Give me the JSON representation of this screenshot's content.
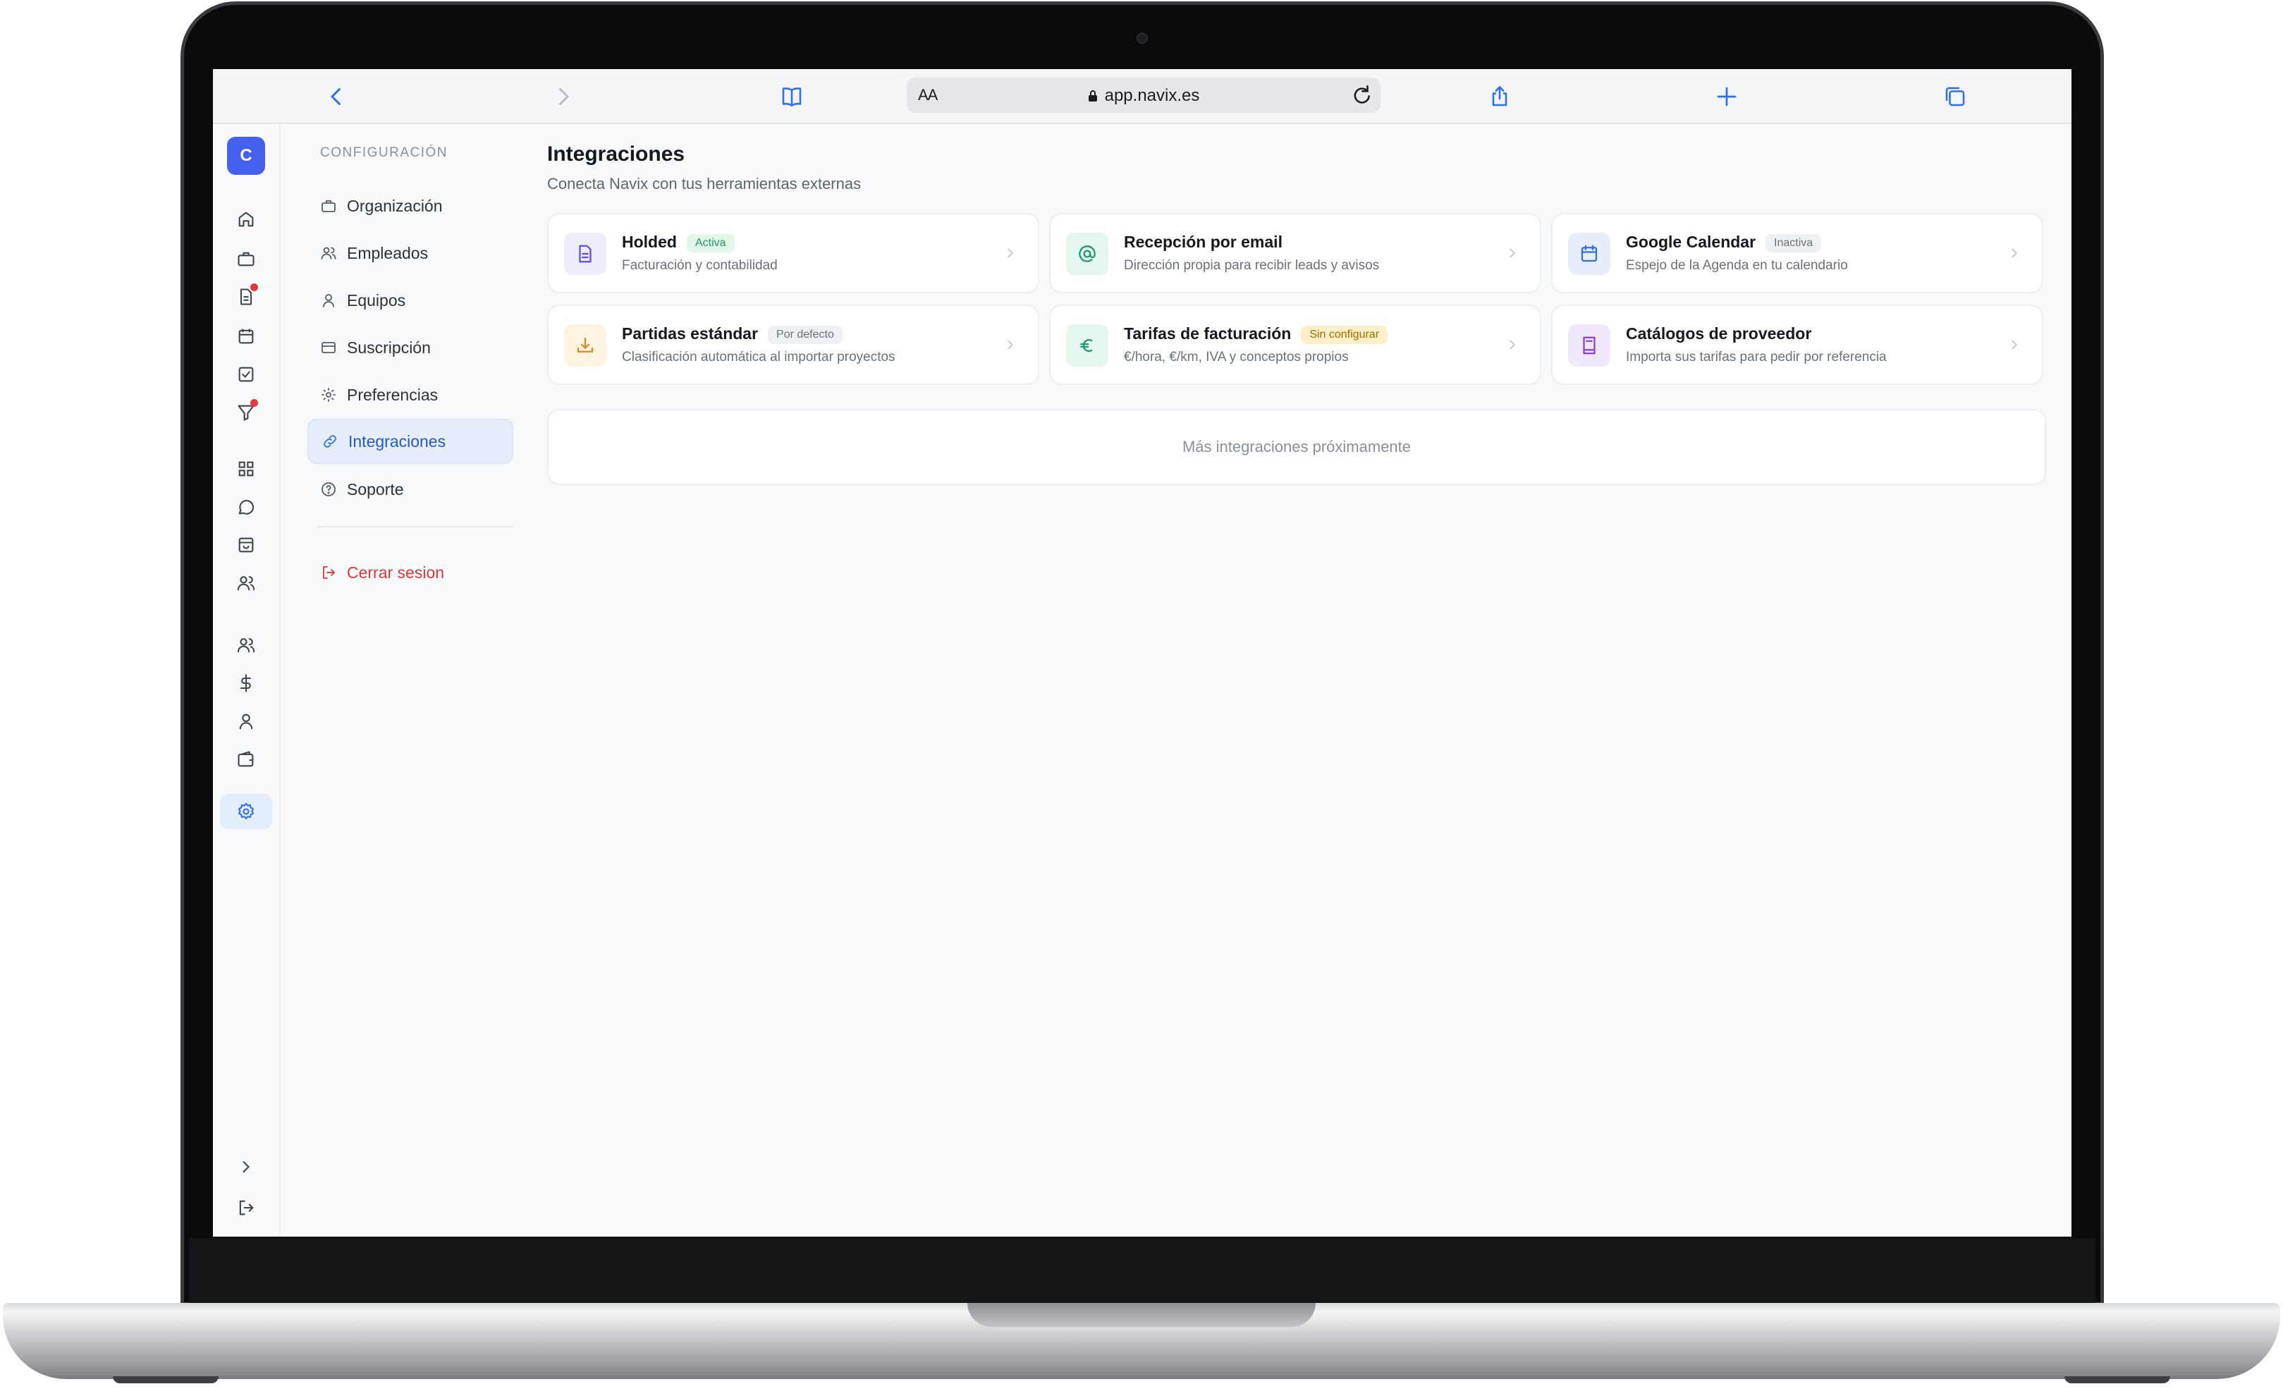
{
  "browser": {
    "url": "app.navix.es",
    "reader_label": "AA"
  },
  "rail": {
    "avatar_initial": "C"
  },
  "nav": {
    "section_title": "CONFIGURACIÓN",
    "items": [
      {
        "label": "Organización",
        "icon": "briefcase-icon"
      },
      {
        "label": "Empleados",
        "icon": "users-icon"
      },
      {
        "label": "Equipos",
        "icon": "user-icon"
      },
      {
        "label": "Suscripción",
        "icon": "credit-card-icon"
      },
      {
        "label": "Preferencias",
        "icon": "sun-icon"
      },
      {
        "label": "Integraciones",
        "icon": "link-icon",
        "active": true
      },
      {
        "label": "Soporte",
        "icon": "help-circle-icon"
      }
    ],
    "logout_label": "Cerrar sesion"
  },
  "main": {
    "title": "Integraciones",
    "subtitle": "Conecta Navix con tus herramientas externas",
    "cards": [
      {
        "title": "Holded",
        "badge": "Activa",
        "badge_color": "#1f9d55",
        "badge_bg": "#e3f6ea",
        "description": "Facturación y contabilidad",
        "icon": "file-text-icon",
        "icon_color": "#5b4fd6",
        "icon_bg": "#eeecfb"
      },
      {
        "title": "Recepción por email",
        "badge": "",
        "description": "Dirección propia para recibir leads y avisos",
        "icon": "at-sign-icon",
        "icon_color": "#1a9a6c",
        "icon_bg": "#e4f6ee"
      },
      {
        "title": "Google Calendar",
        "badge": "Inactiva",
        "badge_color": "#6b717b",
        "badge_bg": "#eef0f3",
        "description": "Espejo de la Agenda en tu calendario",
        "icon": "calendar-icon",
        "icon_color": "#2f6fe6",
        "icon_bg": "#e6eefb"
      },
      {
        "title": "Partidas estándar",
        "badge": "Por defecto",
        "badge_color": "#6b717b",
        "badge_bg": "#eef0f3",
        "description": "Clasificación automática al importar proyectos",
        "icon": "download-icon",
        "icon_color": "#d98a1a",
        "icon_bg": "#fdf3e1"
      },
      {
        "title": "Tarifas de facturación",
        "badge": "Sin configurar",
        "badge_color": "#a36a00",
        "badge_bg": "#fdefc8",
        "description": "€/hora, €/km, IVA y conceptos propios",
        "icon": "euro-icon",
        "icon_color": "#1a9a6c",
        "icon_bg": "#e4f6ee"
      },
      {
        "title": "Catálogos de proveedor",
        "badge": "",
        "description": "Importa sus tarifas para pedir por referencia",
        "icon": "book-icon",
        "icon_color": "#8a3fd1",
        "icon_bg": "#f1e8fb"
      }
    ],
    "more_text": "Más integraciones próximamente"
  }
}
